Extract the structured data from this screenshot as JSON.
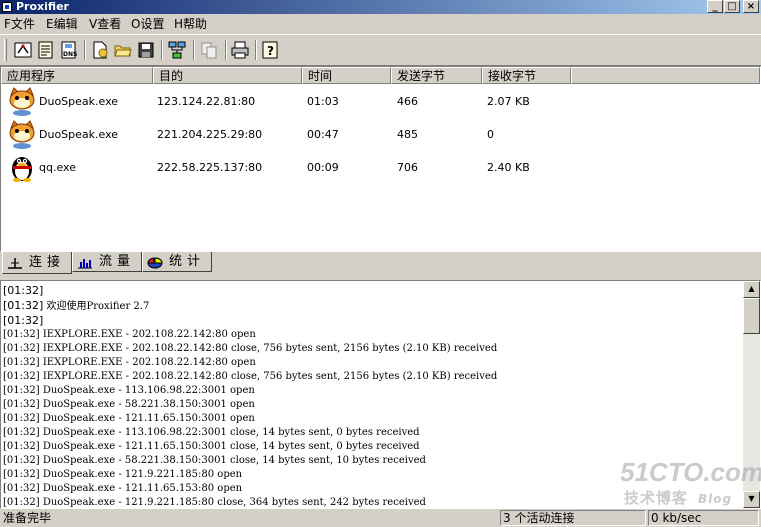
{
  "window": {
    "title": "Proxifier"
  },
  "menu": [
    {
      "label": "F文件"
    },
    {
      "label": "E编辑"
    },
    {
      "label": "V查看"
    },
    {
      "label": "O设置"
    },
    {
      "label": "H帮助"
    }
  ],
  "toolbar": {
    "buttons": [
      {
        "name": "proxy-servers"
      },
      {
        "name": "proxification-rules"
      },
      {
        "name": "name-resolution-dns"
      },
      {
        "name": "new-profile"
      },
      {
        "name": "open-profile"
      },
      {
        "name": "save-profile"
      },
      {
        "name": "connections-view"
      },
      {
        "name": "copy"
      },
      {
        "name": "print"
      },
      {
        "name": "help"
      }
    ]
  },
  "connections": {
    "columns": [
      "应用程序",
      "目的",
      "时间",
      "发送字节",
      "接收字节"
    ],
    "rows": [
      {
        "app": "DuoSpeak.exe",
        "target": "123.124.22.81:80",
        "time": "01:03",
        "sent": "466",
        "received": "2.07 KB",
        "icon": "duospeak-icon"
      },
      {
        "app": "DuoSpeak.exe",
        "target": "221.204.225.29:80",
        "time": "00:47",
        "sent": "485",
        "received": "0",
        "icon": "duospeak-icon"
      },
      {
        "app": "qq.exe",
        "target": "222.58.225.137:80",
        "time": "00:09",
        "sent": "706",
        "received": "2.40 KB",
        "icon": "qq-penguin-icon"
      }
    ]
  },
  "tabs": [
    {
      "label": "连接",
      "active": true
    },
    {
      "label": "流量",
      "active": false
    },
    {
      "label": "统计",
      "active": false
    }
  ],
  "log": [
    {
      "ts": "[01:32]",
      "msg": ""
    },
    {
      "ts": "[01:32]",
      "msg": "欢迎使用Proxifier 2.7"
    },
    {
      "ts": "[01:32]",
      "msg": ""
    },
    {
      "ts": "[01:32]",
      "msg": "IEXPLORE.EXE - 202.108.22.142:80 open"
    },
    {
      "ts": "[01:32]",
      "msg": "IEXPLORE.EXE - 202.108.22.142:80 close, 756 bytes sent, 2156 bytes (2.10 KB) received"
    },
    {
      "ts": "[01:32]",
      "msg": "IEXPLORE.EXE - 202.108.22.142:80 open"
    },
    {
      "ts": "[01:32]",
      "msg": "IEXPLORE.EXE - 202.108.22.142:80 close, 756 bytes sent, 2156 bytes (2.10 KB) received"
    },
    {
      "ts": "[01:32]",
      "msg": "DuoSpeak.exe - 113.106.98.22:3001 open"
    },
    {
      "ts": "[01:32]",
      "msg": "DuoSpeak.exe - 58.221.38.150:3001 open"
    },
    {
      "ts": "[01:32]",
      "msg": "DuoSpeak.exe - 121.11.65.150:3001 open"
    },
    {
      "ts": "[01:32]",
      "msg": "DuoSpeak.exe - 113.106.98.22:3001 close, 14 bytes sent, 0 bytes received"
    },
    {
      "ts": "[01:32]",
      "msg": "DuoSpeak.exe - 121.11.65.150:3001 close, 14 bytes sent, 0 bytes received"
    },
    {
      "ts": "[01:32]",
      "msg": "DuoSpeak.exe - 58.221.38.150:3001 close, 14 bytes sent, 10 bytes received"
    },
    {
      "ts": "[01:32]",
      "msg": "DuoSpeak.exe - 121.9.221.185:80 open"
    },
    {
      "ts": "[01:32]",
      "msg": "DuoSpeak.exe - 121.11.65.153:80 open"
    },
    {
      "ts": "[01:32]",
      "msg": "DuoSpeak.exe - 121.9.221.185:80 close, 364 bytes sent, 242 bytes received"
    }
  ],
  "watermark": {
    "main": "51CTO.com",
    "sub": "技术博客",
    "blog": "Blog"
  },
  "status": {
    "ready": "准备完毕",
    "active_connections": "3 个活动连接",
    "rate": "0 kb/sec"
  }
}
